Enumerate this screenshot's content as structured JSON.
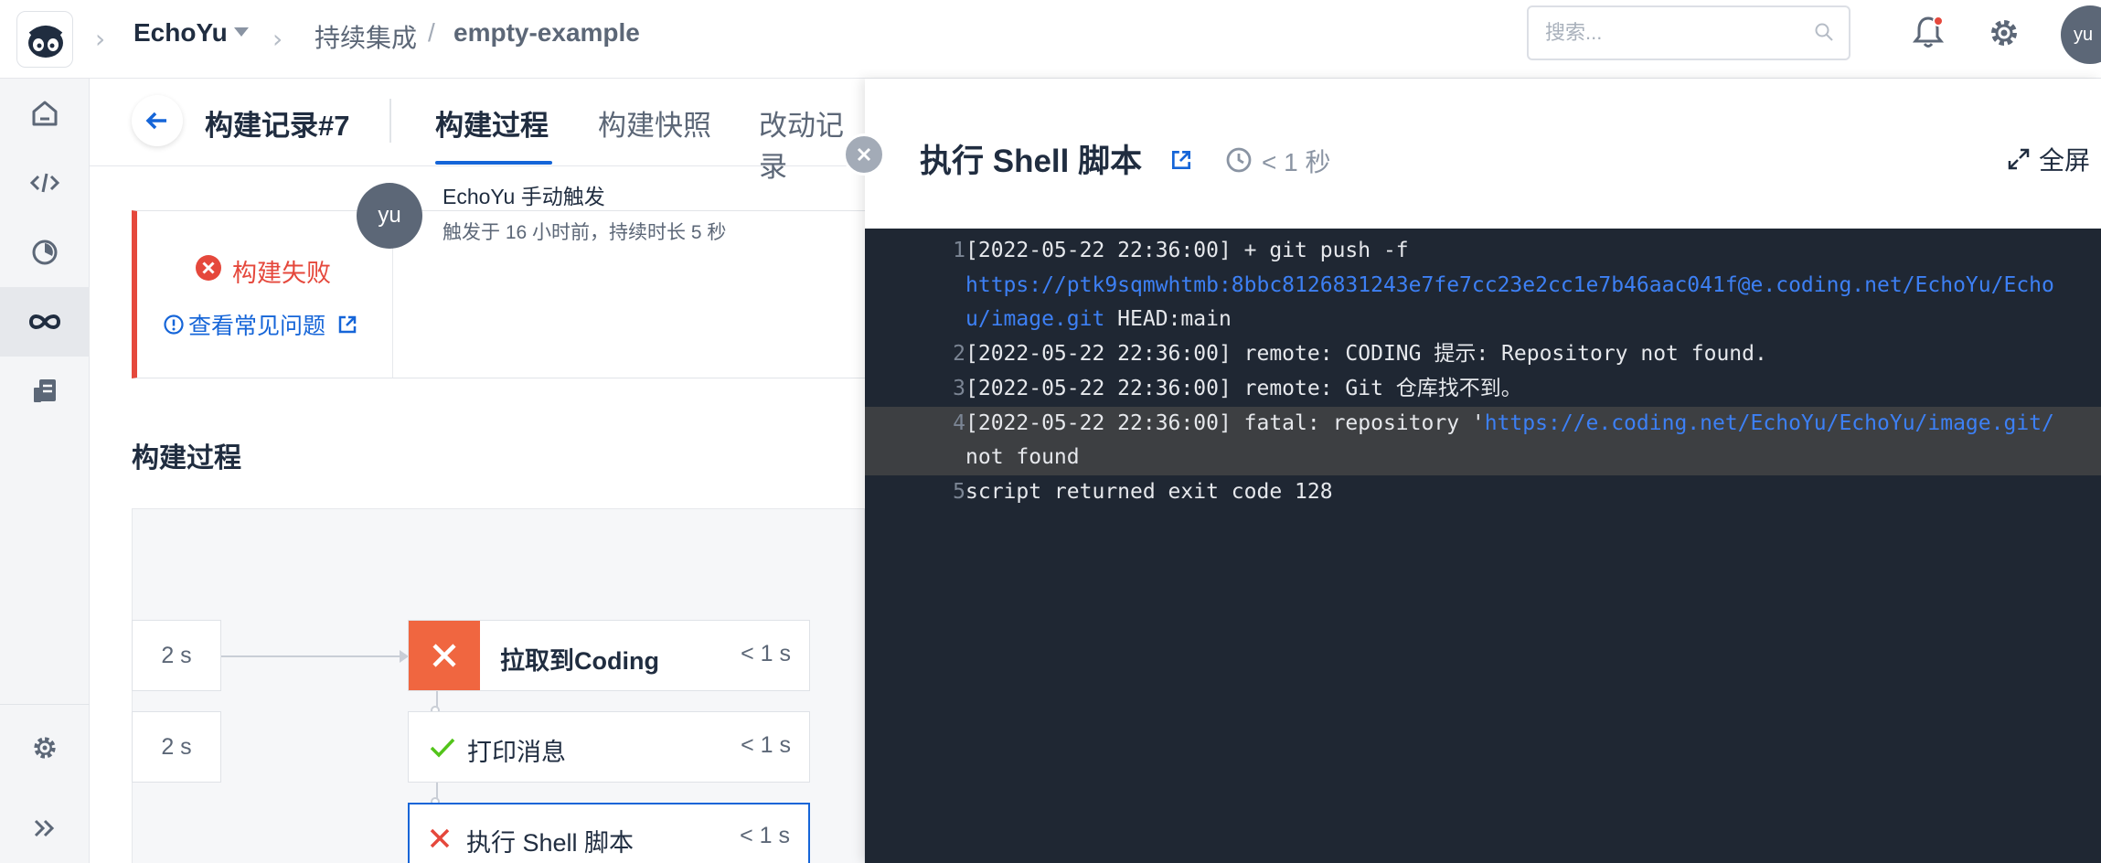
{
  "topbar": {
    "team": "EchoYu",
    "crumb_ci": "持续集成",
    "slash": "/",
    "project": "empty-example",
    "search_placeholder": "搜索...",
    "avatar": "yu"
  },
  "colors": {
    "accent": "#1565d8",
    "danger": "#e5483c",
    "success": "#52c41a",
    "log_bg": "#1f2733",
    "link": "#3d80f5"
  },
  "sidebar": {
    "items": [
      {
        "icon": "home-icon"
      },
      {
        "icon": "code-icon"
      },
      {
        "icon": "gauge-icon"
      },
      {
        "icon": "infinity-icon",
        "active": true
      },
      {
        "icon": "artifact-icon"
      }
    ],
    "bottom": [
      {
        "icon": "gear-icon"
      },
      {
        "icon": "expand-icon"
      }
    ]
  },
  "subheader": {
    "title": "构建记录#7",
    "tabs": [
      {
        "label": "构建过程",
        "active": true
      },
      {
        "label": "构建快照"
      },
      {
        "label": "改动记录"
      }
    ]
  },
  "status": {
    "result": "构建失败",
    "faq": "查看常见问题",
    "trigger_avatar": "yu",
    "trigger_user": "EchoYu",
    "trigger_action": "手动触发",
    "trigger_detail": "触发于 16 小时前，持续时长 5 秒"
  },
  "pipeline": {
    "section_title": "构建过程",
    "stage_times": [
      "2 s",
      "2 s"
    ],
    "steps": [
      {
        "name": "拉取到Coding",
        "time": "< 1 s",
        "status": "failed"
      },
      {
        "name": "打印消息",
        "time": "< 1 s",
        "status": "success"
      },
      {
        "name": "执行 Shell 脚本",
        "time": "< 1 s",
        "status": "failed"
      }
    ]
  },
  "drawer": {
    "title": "执行 Shell 脚本",
    "duration": "< 1 秒",
    "fullscreen": "全屏"
  },
  "log": {
    "lines": [
      {
        "n": "1",
        "segments": [
          {
            "t": "[2022-05-22 22:36:00] + git push -f"
          }
        ]
      },
      {
        "n": "",
        "segments": [
          {
            "t": "https://ptk9sqmwhtmb:8bbc8126831243e7fe7cc23e2cc1e7b46aac041f@e.coding.net/EchoYu/Echo",
            "url": true
          }
        ]
      },
      {
        "n": "",
        "segments": [
          {
            "t": "u/image.git",
            "url": true
          },
          {
            "t": " HEAD:main"
          }
        ]
      },
      {
        "n": "2",
        "segments": [
          {
            "t": "[2022-05-22 22:36:00] remote: CODING 提示: Repository not found."
          }
        ]
      },
      {
        "n": "3",
        "segments": [
          {
            "t": "[2022-05-22 22:36:00] remote: Git 仓库找不到。"
          }
        ]
      },
      {
        "n": "4",
        "hl": true,
        "segments": [
          {
            "t": "[2022-05-22 22:36:00] fatal: repository '"
          },
          {
            "t": "https://e.coding.net/EchoYu/EchoYu/image.git/",
            "url": true
          }
        ]
      },
      {
        "n": "",
        "hl": true,
        "segments": [
          {
            "t": "not found"
          }
        ]
      },
      {
        "n": "5",
        "segments": [
          {
            "t": "script returned exit code 128"
          }
        ]
      }
    ]
  }
}
